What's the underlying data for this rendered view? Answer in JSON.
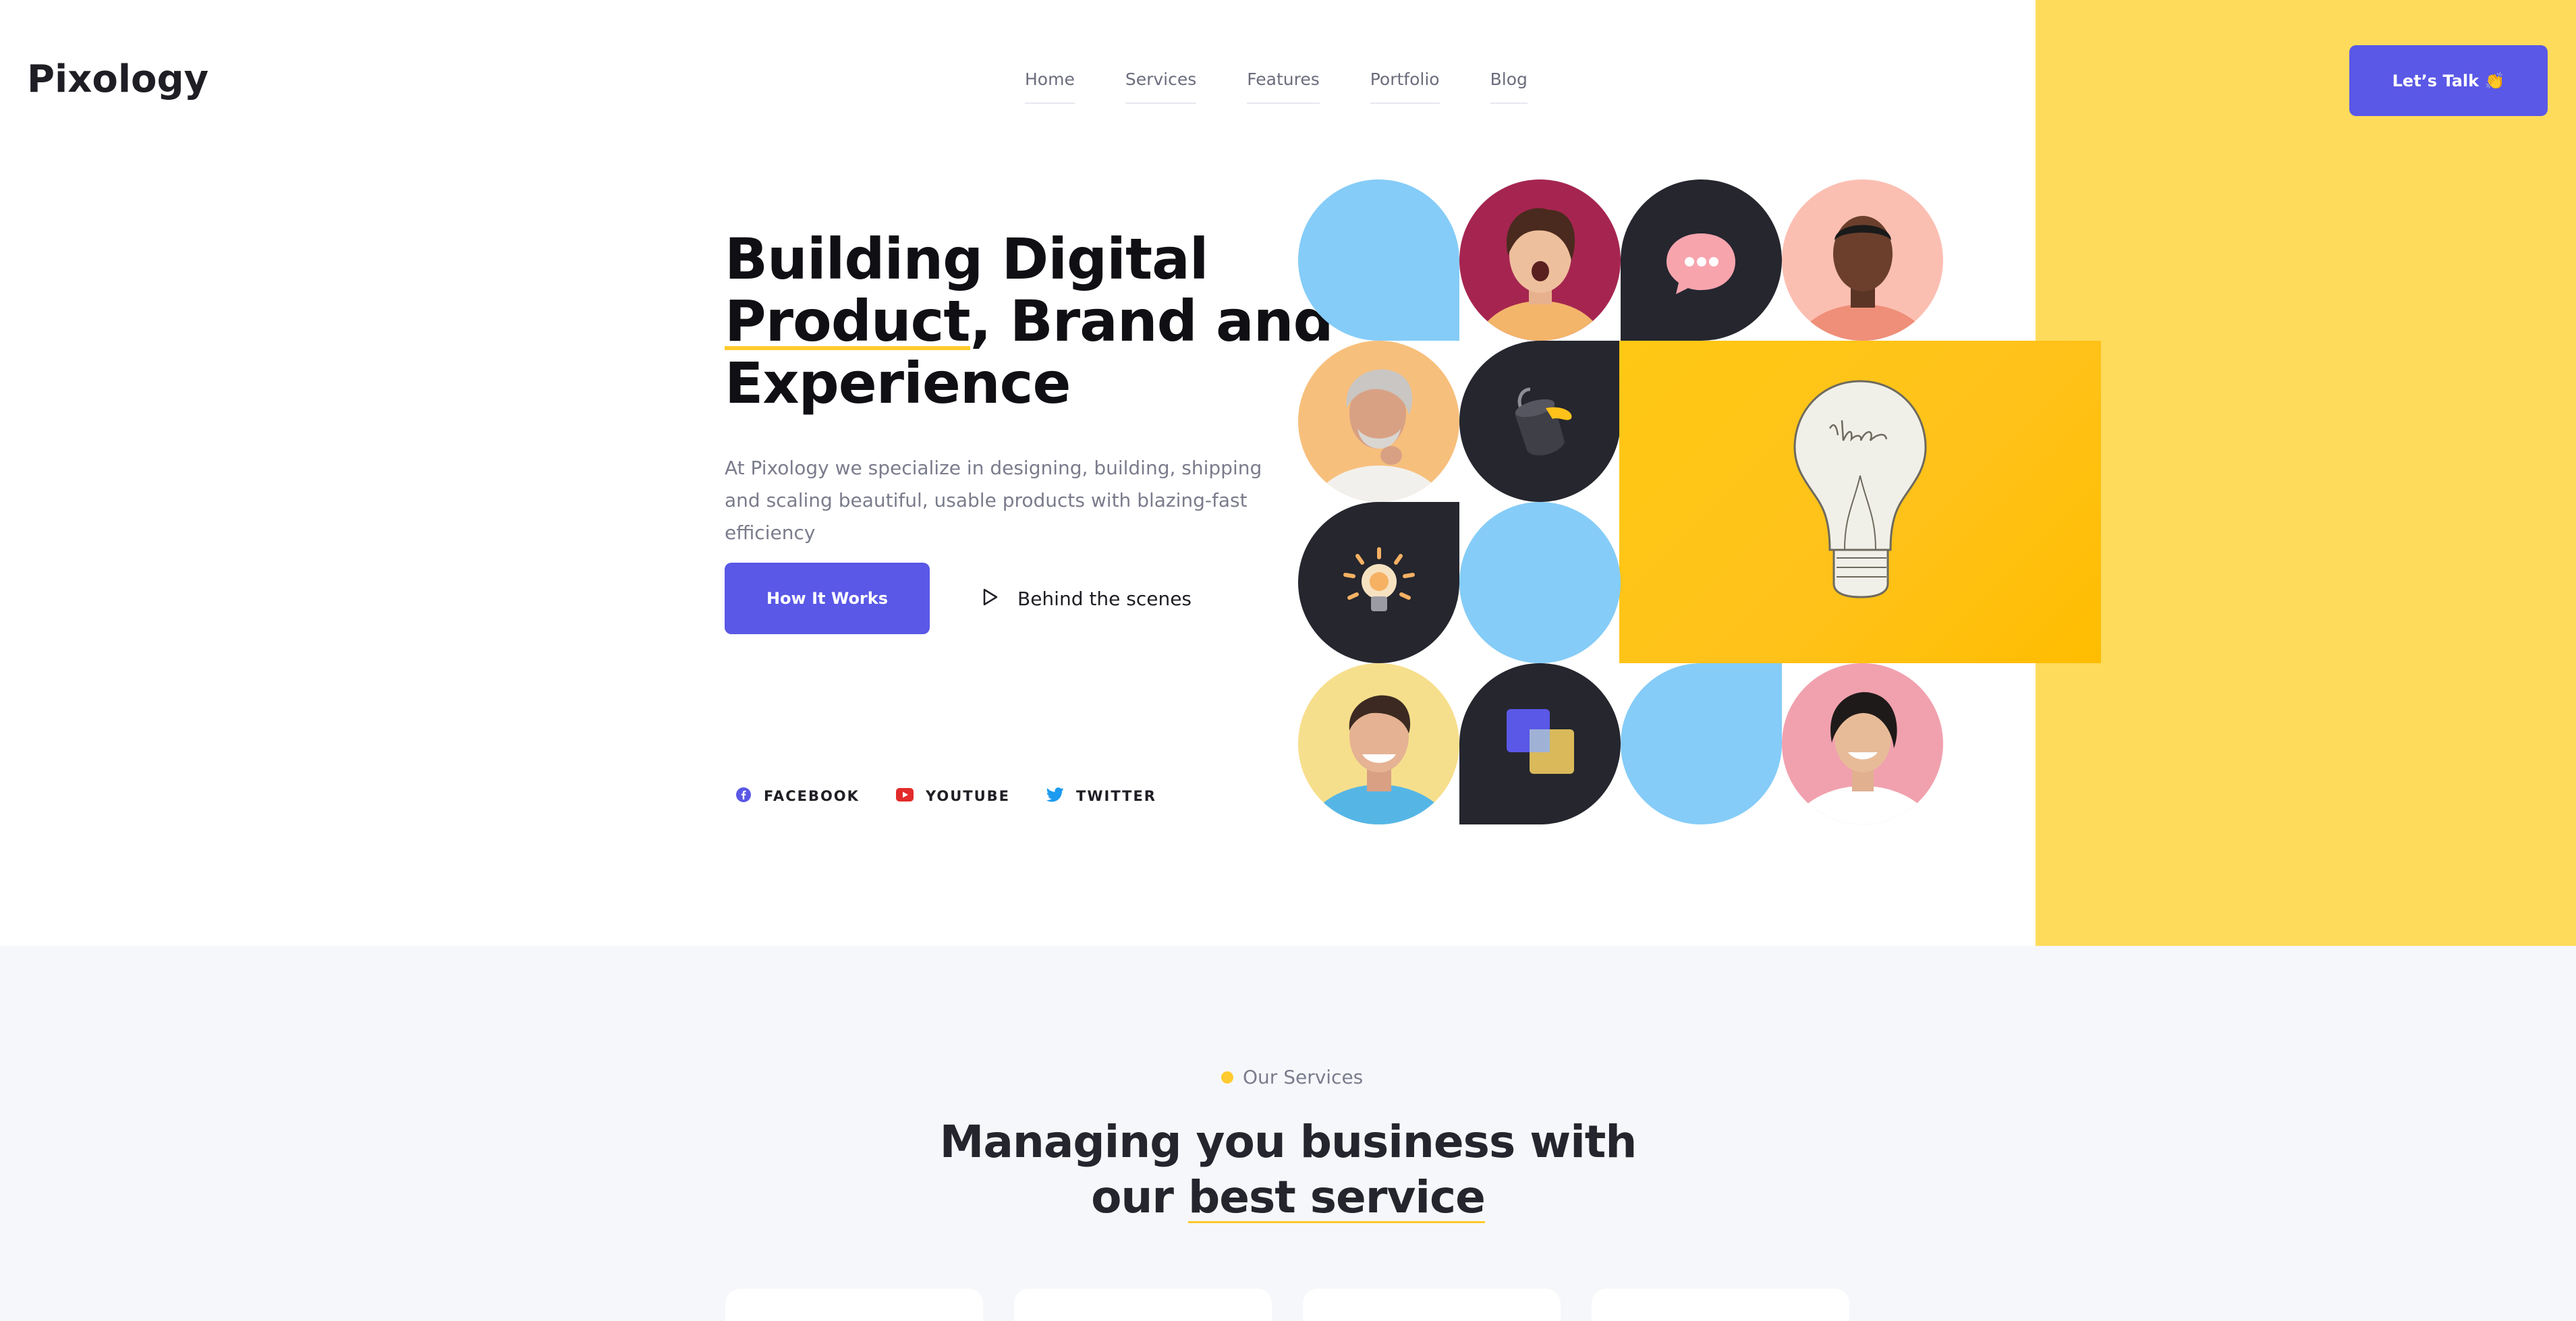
{
  "brand": {
    "name": "Pixology",
    "accent": "#5a58e6",
    "yellow": "#ffdb5c",
    "highlight": "#ffcb2e"
  },
  "nav": {
    "items": [
      {
        "label": "Home"
      },
      {
        "label": "Services"
      },
      {
        "label": "Features"
      },
      {
        "label": "Portfolio"
      },
      {
        "label": "Blog"
      }
    ],
    "cta_label": "Let’s Talk 👏"
  },
  "hero": {
    "title_line1": "Building Digital",
    "title_line2_underlined": "Product",
    "title_line2_rest": ", Brand and",
    "title_line3": "Experience",
    "description": "At Pixology we specialize in designing, building, shipping and scaling beautiful, usable products with blazing-fast efficiency",
    "primary_button": "How It Works",
    "secondary_link": "Behind the scenes"
  },
  "socials": [
    {
      "label": "FACEBOOK",
      "icon": "facebook-icon"
    },
    {
      "label": "YOUTUBE",
      "icon": "youtube-icon"
    },
    {
      "label": "TWITTER",
      "icon": "twitter-icon"
    }
  ],
  "mosaic": {
    "icons": [
      "chat-bubble-icon",
      "paint-bucket-icon",
      "lightbulb-icon",
      "layers-icon",
      "idea-bulb-illustration"
    ]
  },
  "services": {
    "tag": "Our Services",
    "title_line1": "Managing you business with",
    "title_line2_plain": "our ",
    "title_line2_underlined": "best service"
  }
}
